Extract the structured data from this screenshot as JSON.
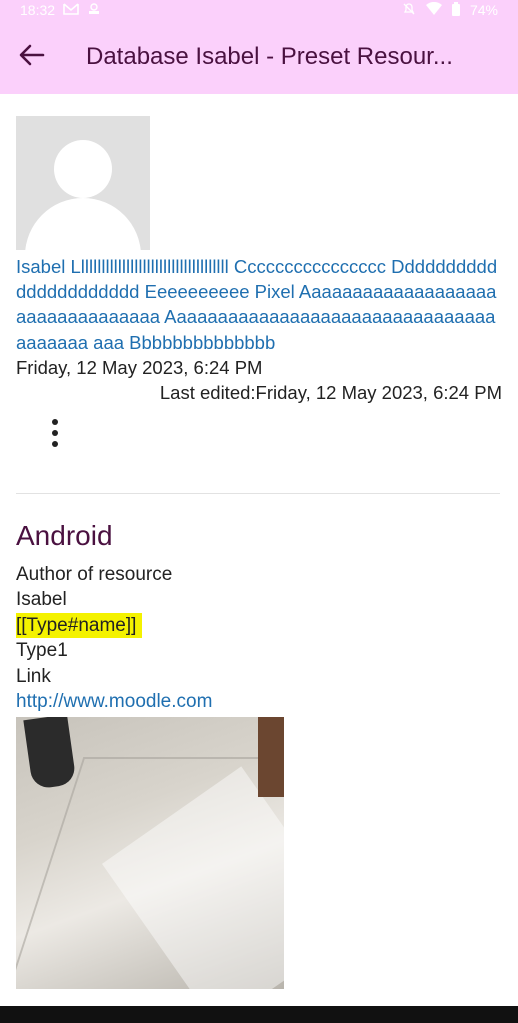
{
  "status_bar": {
    "time": "18:32",
    "battery": "74%"
  },
  "app_bar": {
    "title": "Database Isabel - Preset Resour..."
  },
  "entry": {
    "author_text": "Isabel Lllllllllllllllllllllllllllllllllllll Cccccccccccccccc Dddddddddddddddddddddd Eeeeeeeeee Pixel Aaaaaaaaaaaaaaaaaaaaaaaaaaaaaaaaa Aaaaaaaaaaaaaaaaaaaaaaaaaaaaaaaaaaaaaaa aaa Bbbbbbbbbbbbbb",
    "date": "Friday, 12 May 2023, 6:24 PM",
    "last_edited": "Last edited:Friday, 12 May 2023, 6:24 PM"
  },
  "section": {
    "title": "Android",
    "fields": {
      "author_label": "Author of resource",
      "author_value": "Isabel",
      "type_label": "[[Type#name]]",
      "type_value": "Type1",
      "link_label": "Link",
      "link_value": "http://www.moodle.com"
    }
  },
  "icons": {
    "back": "arrow-left-icon",
    "more": "more-vert-icon",
    "wifi": "wifi-icon",
    "battery": "battery-icon",
    "mute": "bell-off-icon",
    "gmail": "gmail-icon"
  },
  "colors": {
    "app_bar": "#fbd0fb",
    "title": "#4a1140",
    "link": "#1f6fb0",
    "highlight": "#f4f200"
  }
}
